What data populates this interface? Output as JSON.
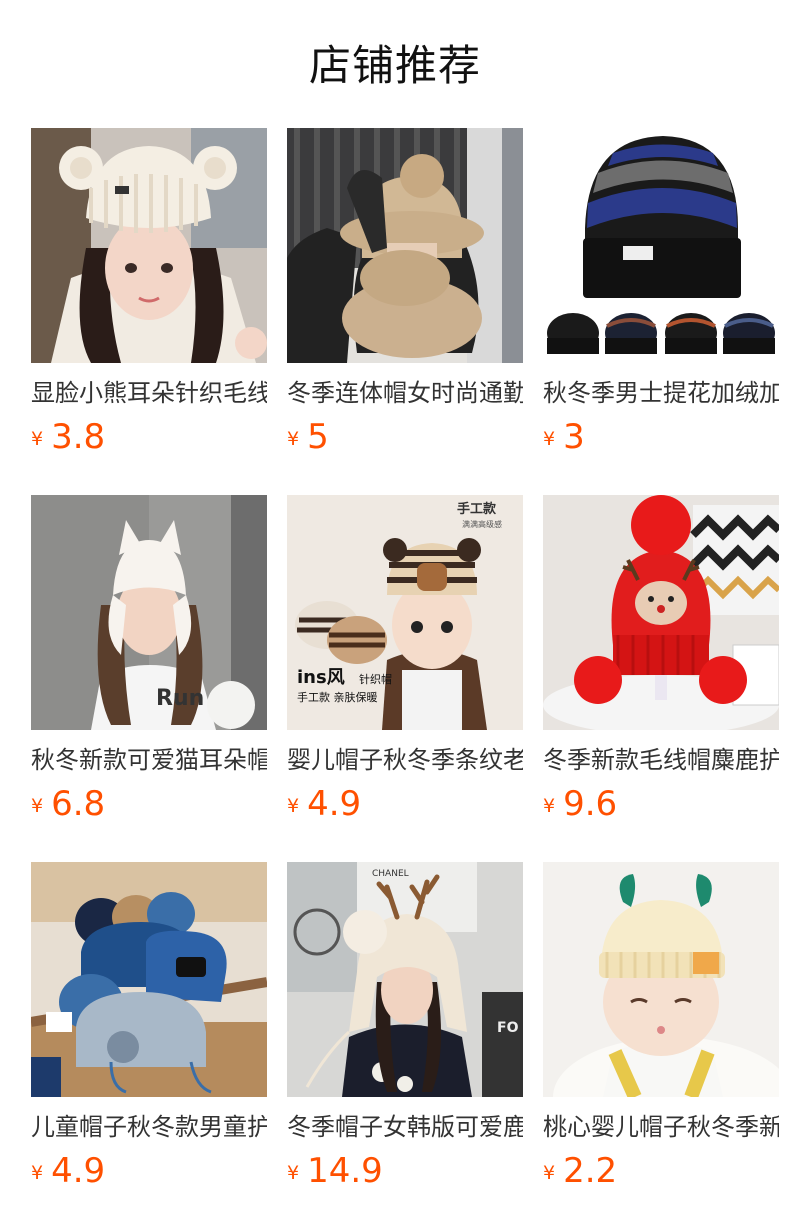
{
  "header": {
    "title": "店铺推荐"
  },
  "currency_symbol": "¥",
  "products": [
    {
      "name": "显脸小熊耳朵针织毛线帽",
      "price": "3.8",
      "image": "cream-bear-ear-knit-hat"
    },
    {
      "name": "冬季连体帽女时尚通勤",
      "price": "5",
      "image": "beige-fur-balaclava-hat"
    },
    {
      "name": "秋冬季男士提花加绒加厚",
      "price": "3",
      "image": "striped-mens-beanie"
    },
    {
      "name": "秋冬新款可爱猫耳朵帽子",
      "price": "6.8",
      "image": "white-cat-ear-fur-hat"
    },
    {
      "name": "婴儿帽子秋冬季条纹老虎",
      "price": "4.9",
      "image": "baby-tiger-stripe-hat"
    },
    {
      "name": "冬季新款毛线帽麋鹿护耳",
      "price": "9.6",
      "image": "red-reindeer-pompom-hat"
    },
    {
      "name": "儿童帽子秋冬款男童护耳",
      "price": "4.9",
      "image": "kids-blue-earflap-hats"
    },
    {
      "name": "冬季帽子女韩版可爱鹿角",
      "price": "14.9",
      "image": "antler-fur-earflap-hat"
    },
    {
      "name": "桃心婴儿帽子秋冬季新款",
      "price": "2.2",
      "image": "baby-heart-horn-beanie"
    }
  ],
  "colors": {
    "price": "#ff5000",
    "title": "#111111",
    "name": "#333333"
  }
}
